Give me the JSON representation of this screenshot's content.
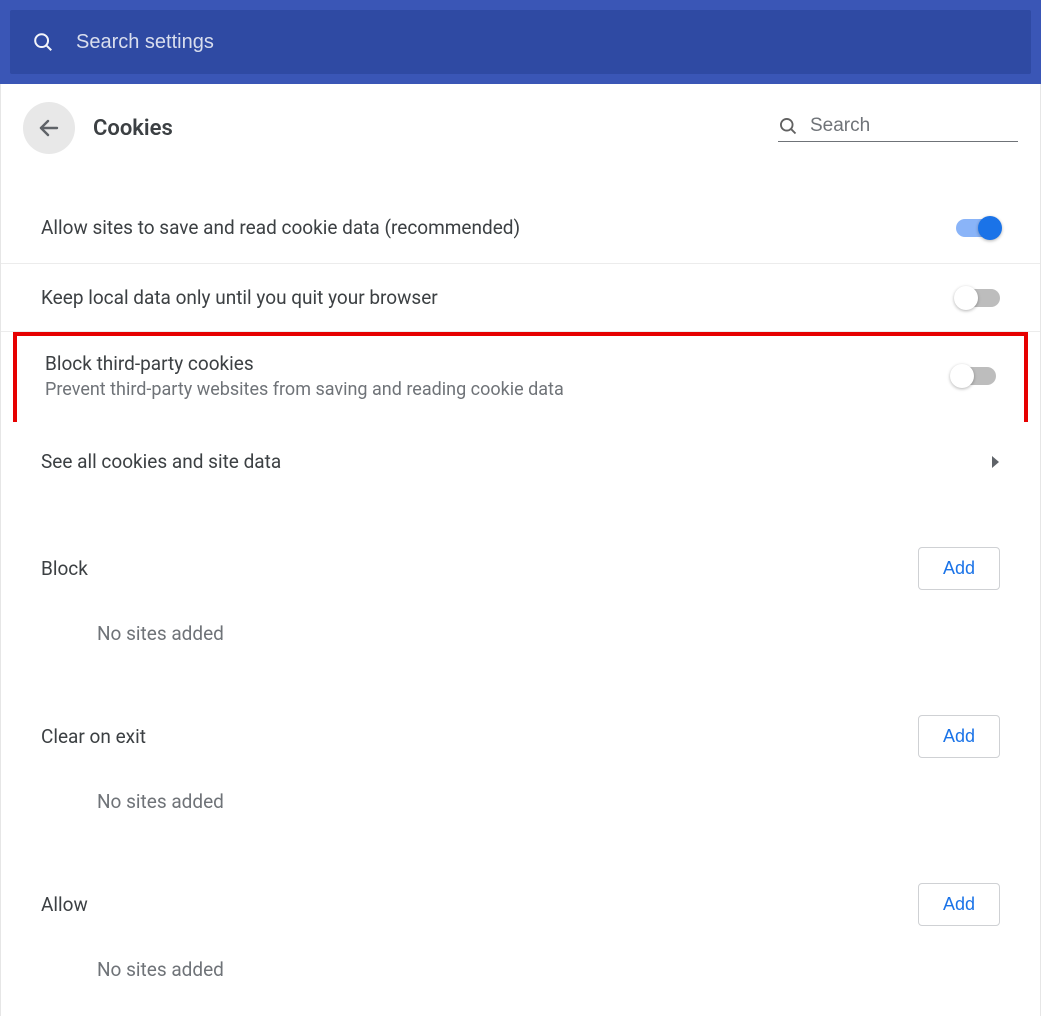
{
  "topSearch": {
    "placeholder": "Search settings"
  },
  "header": {
    "title": "Cookies",
    "searchPlaceholder": "Search"
  },
  "options": {
    "allowCookies": {
      "title": "Allow sites to save and read cookie data (recommended)",
      "on": true
    },
    "keepLocal": {
      "title": "Keep local data only until you quit your browser",
      "on": false
    },
    "blockThirdParty": {
      "title": "Block third-party cookies",
      "subtitle": "Prevent third-party websites from saving and reading cookie data",
      "on": false
    },
    "seeAll": {
      "title": "See all cookies and site data"
    }
  },
  "sections": {
    "block": {
      "title": "Block",
      "add": "Add",
      "empty": "No sites added"
    },
    "clearOnExit": {
      "title": "Clear on exit",
      "add": "Add",
      "empty": "No sites added"
    },
    "allow": {
      "title": "Allow",
      "add": "Add",
      "empty": "No sites added"
    }
  }
}
